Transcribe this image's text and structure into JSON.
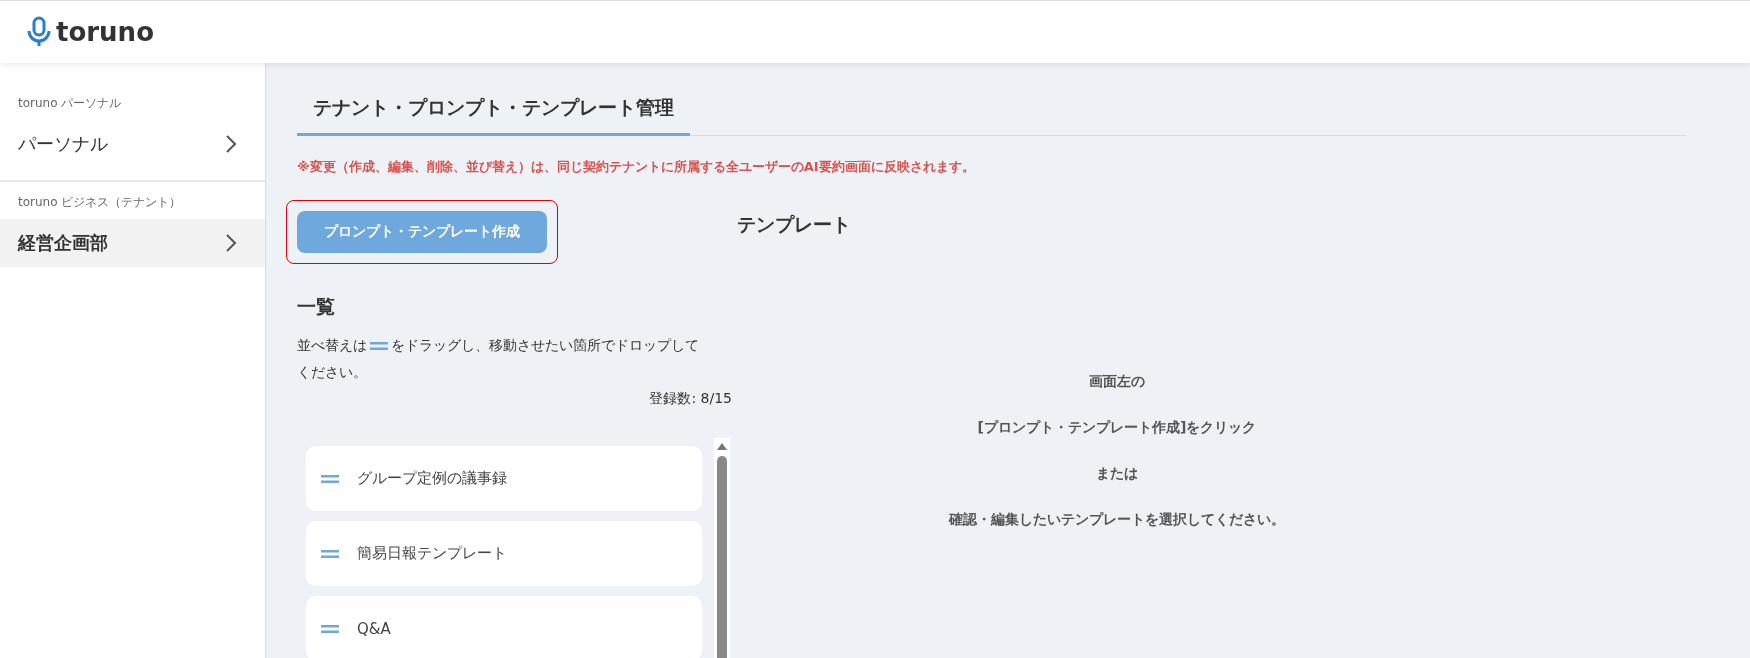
{
  "header": {
    "logo_text": "toruno"
  },
  "sidebar": {
    "groups": [
      {
        "label": "toruno パーソナル",
        "item": "パーソナル",
        "selected": false
      },
      {
        "label": "toruno ビジネス（テナント）",
        "item": "経営企画部",
        "selected": true
      }
    ]
  },
  "tabs": [
    {
      "label": "テナント・プロンプト・テンプレート管理",
      "selected": true
    }
  ],
  "notice": "※変更（作成、編集、削除、並び替え）は、同じ契約テナントに所属する全ユーザーのAI要約画面に反映されます。",
  "create_button": {
    "label": "プロンプト・テンプレート作成",
    "highlighted": true
  },
  "list": {
    "title": "一覧",
    "hint_before": "並べ替えは",
    "hint_after": "をドラッグし、移動させたい箇所でドロップして",
    "hint_last_line": "ください。",
    "count": "登録数: 8/15",
    "items": [
      "グループ定例の議事録",
      "簡易日報テンプレート",
      "Q&A"
    ]
  },
  "detail": {
    "title": "テンプレート",
    "lines": [
      "画面左の",
      "[プロンプト・テンプレート作成]をクリック",
      "または",
      "確認・編集したいテンプレートを選択してください。"
    ]
  }
}
